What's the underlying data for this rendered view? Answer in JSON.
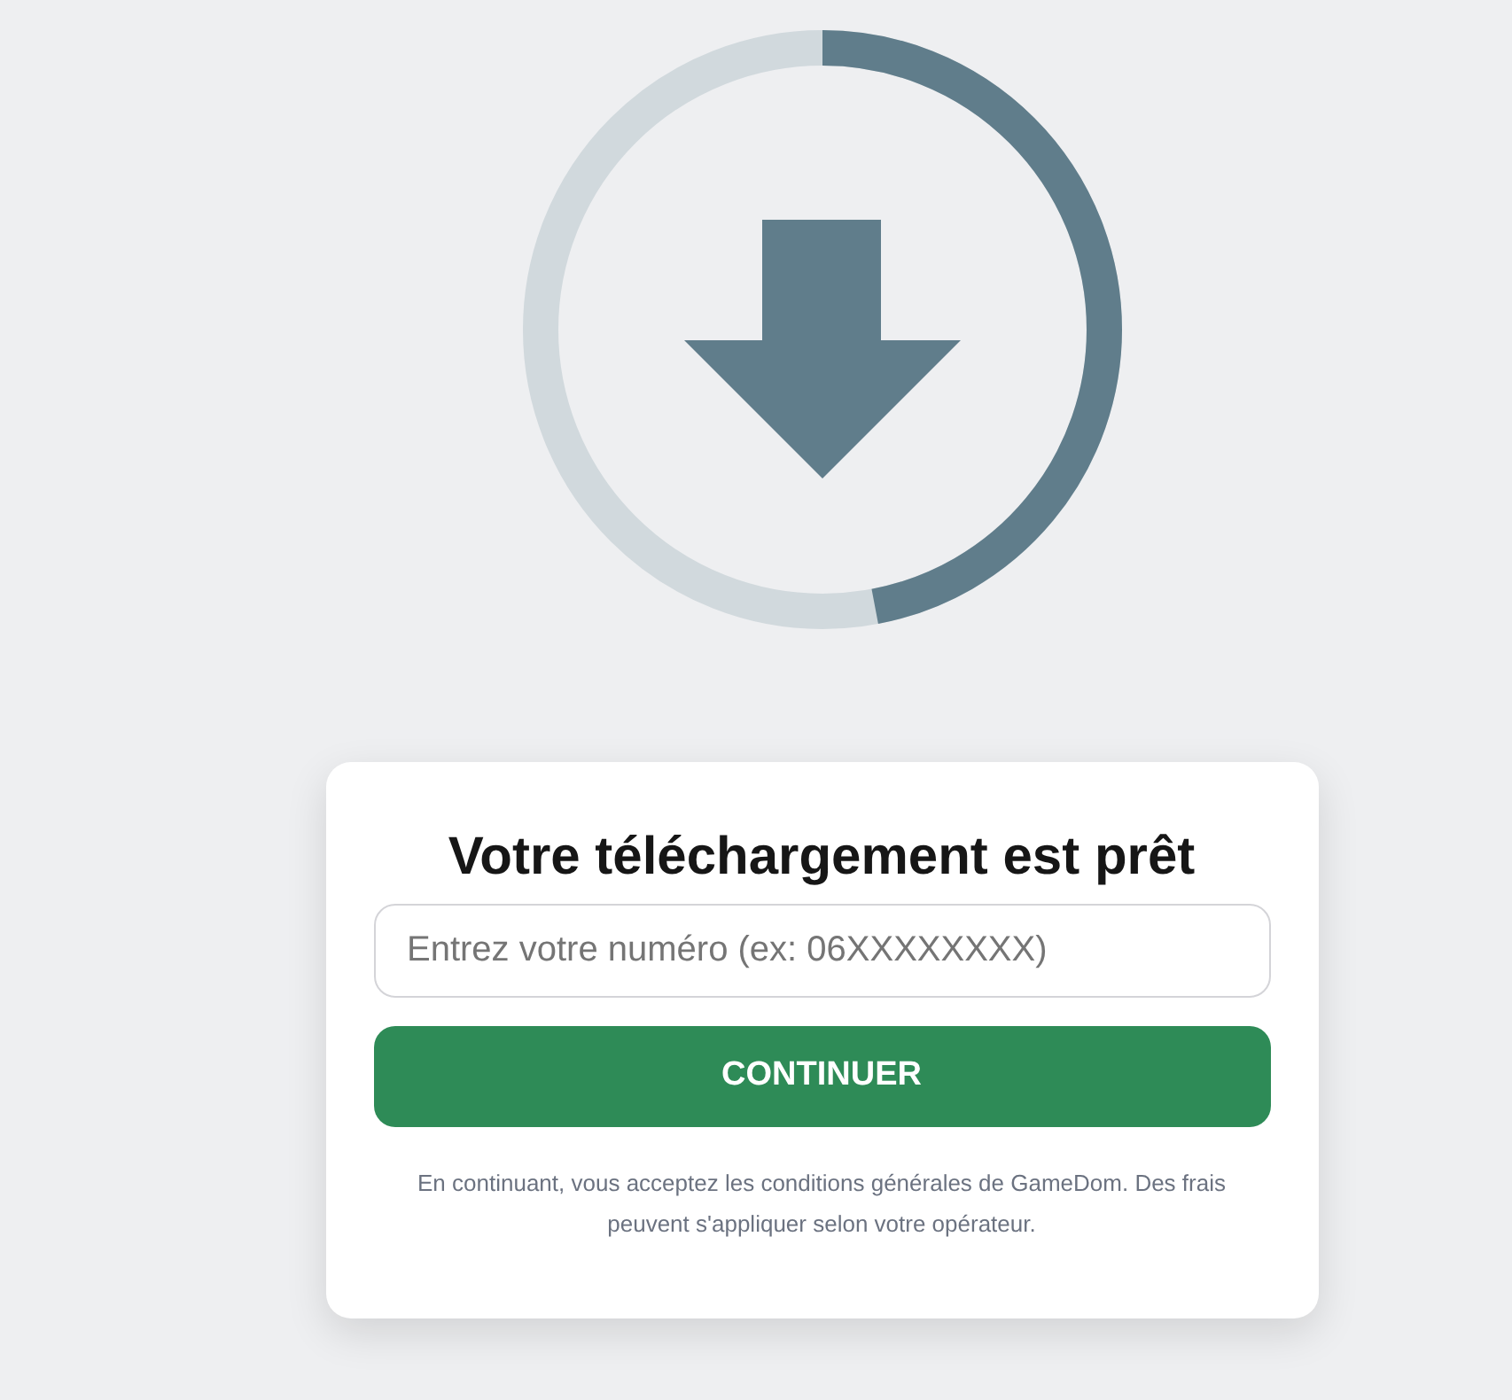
{
  "download_progress": {
    "level": 0.47
  },
  "card": {
    "title": "Votre téléchargement est prêt",
    "phone_field": {
      "placeholder": "Entrez votre numéro (ex: 06XXXXXXXX)"
    },
    "continue_button": "CONTINUER",
    "terms": "En continuant, vous acceptez les conditions générales de GameDom. Des frais peuvent s'appliquer selon votre opérateur."
  }
}
